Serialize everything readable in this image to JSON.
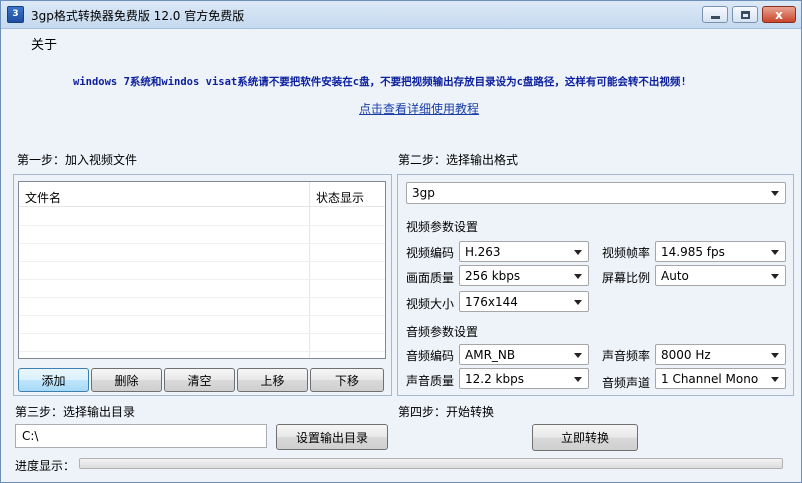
{
  "window": {
    "title": "3gp格式转换器免费版 12.0 官方免费版",
    "close_symbol": "x"
  },
  "header": {
    "about": "关于",
    "notice": "windows 7系统和windos visat系统请不要把软件安装在c盘，不要把视频输出存放目录设为c盘路径，这样有可能会转不出视频!",
    "help_link": "点击查看详细使用教程"
  },
  "step1": {
    "title": "第一步：加入视频文件",
    "columns": [
      "文件名",
      "状态显示"
    ],
    "buttons": [
      "添加",
      "删除",
      "清空",
      "上移",
      "下移"
    ]
  },
  "step2": {
    "title": "第二步：选择输出格式",
    "format": "3gp",
    "video_section": "视频参数设置",
    "video": {
      "codec_label": "视频编码",
      "codec": "H.263",
      "framerate_label": "视频帧率",
      "framerate": "14.985 fps",
      "quality_label": "画面质量",
      "quality": "256 kbps",
      "aspect_label": "屏幕比例",
      "aspect": "Auto",
      "size_label": "视频大小",
      "size": "176x144"
    },
    "audio_section": "音频参数设置",
    "audio": {
      "codec_label": "音频编码",
      "codec": "AMR_NB",
      "samplerate_label": "声音频率",
      "samplerate": "8000 Hz",
      "quality_label": "声音质量",
      "quality": "12.2 kbps",
      "channels_label": "音频声道",
      "channels": "1 Channel Mono"
    }
  },
  "step3": {
    "title": "第三步：选择输出目录",
    "path": "C:\\",
    "button": "设置输出目录"
  },
  "step4": {
    "title": "第四步：开始转换",
    "button": "立即转换"
  },
  "progress": {
    "label": "进度显示：",
    "value": 0
  }
}
